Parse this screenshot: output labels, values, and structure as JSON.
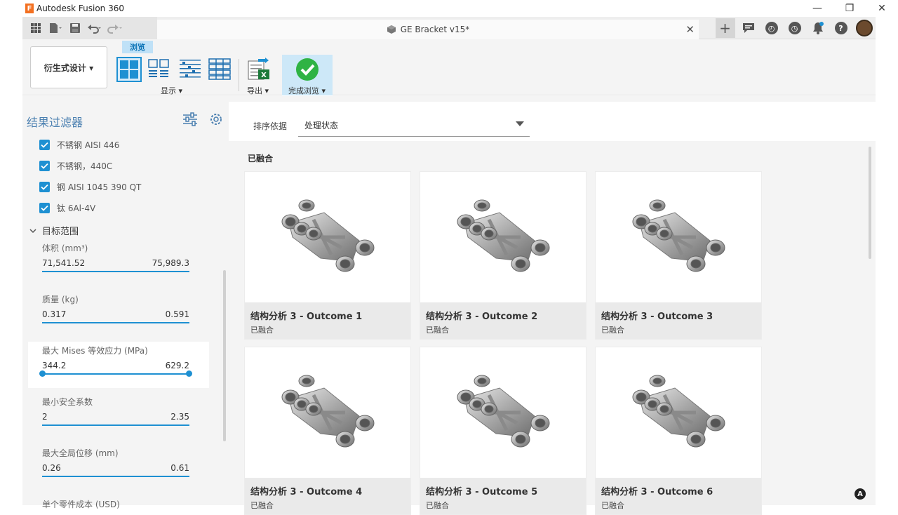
{
  "window": {
    "app_logo_letter": "F",
    "app_title": "Autodesk Fusion 360",
    "minimize": "—",
    "restore": "❐",
    "close": "✕"
  },
  "qat": {
    "doc_title": "GE Bracket v15*",
    "doc_close": "✕",
    "plus": "+"
  },
  "ribbon": {
    "workspace": "衍生式设计 ▾",
    "active_tab": "浏览",
    "display_label": "显示 ▾",
    "export_label": "导出 ▾",
    "finish_label": "完成浏览 ▾"
  },
  "sidebar": {
    "title": "结果过滤器",
    "materials": [
      "不锈钢 AISI 446",
      "不锈钢，440C",
      "钢 AISI 1045 390 QT",
      "钛 6Al-4V"
    ],
    "section_title": "目标范围",
    "ranges": [
      {
        "label": "体积 (mm³)",
        "min": "71,541.52",
        "max": "75,989.3"
      },
      {
        "label": "质量 (kg)",
        "min": "0.317",
        "max": "0.591"
      },
      {
        "label": "最大 Mises 等效应力 (MPa)",
        "min": "344.2",
        "max": "629.2"
      },
      {
        "label": "最小安全系数",
        "min": "2",
        "max": "2.35"
      },
      {
        "label": "最大全局位移 (mm)",
        "min": "0.26",
        "max": "0.61"
      },
      {
        "label": "单个零件成本 (USD)"
      }
    ]
  },
  "main": {
    "sort_label": "排序依据",
    "sort_value": "处理状态",
    "group_label": "已融合",
    "cards": [
      {
        "title": "结构分析 3 - Outcome 1",
        "status": "已融合"
      },
      {
        "title": "结构分析 3 - Outcome 2",
        "status": "已融合"
      },
      {
        "title": "结构分析 3 - Outcome 3",
        "status": "已融合"
      },
      {
        "title": "结构分析 3 - Outcome 4",
        "status": "已融合"
      },
      {
        "title": "结构分析 3 - Outcome 5",
        "status": "已融合"
      },
      {
        "title": "结构分析 3 - Outcome 6",
        "status": "已融合"
      }
    ]
  },
  "colors": {
    "accent": "#1e90d2",
    "title_blue": "#4a7fb0",
    "finish_green": "#2fb344"
  }
}
